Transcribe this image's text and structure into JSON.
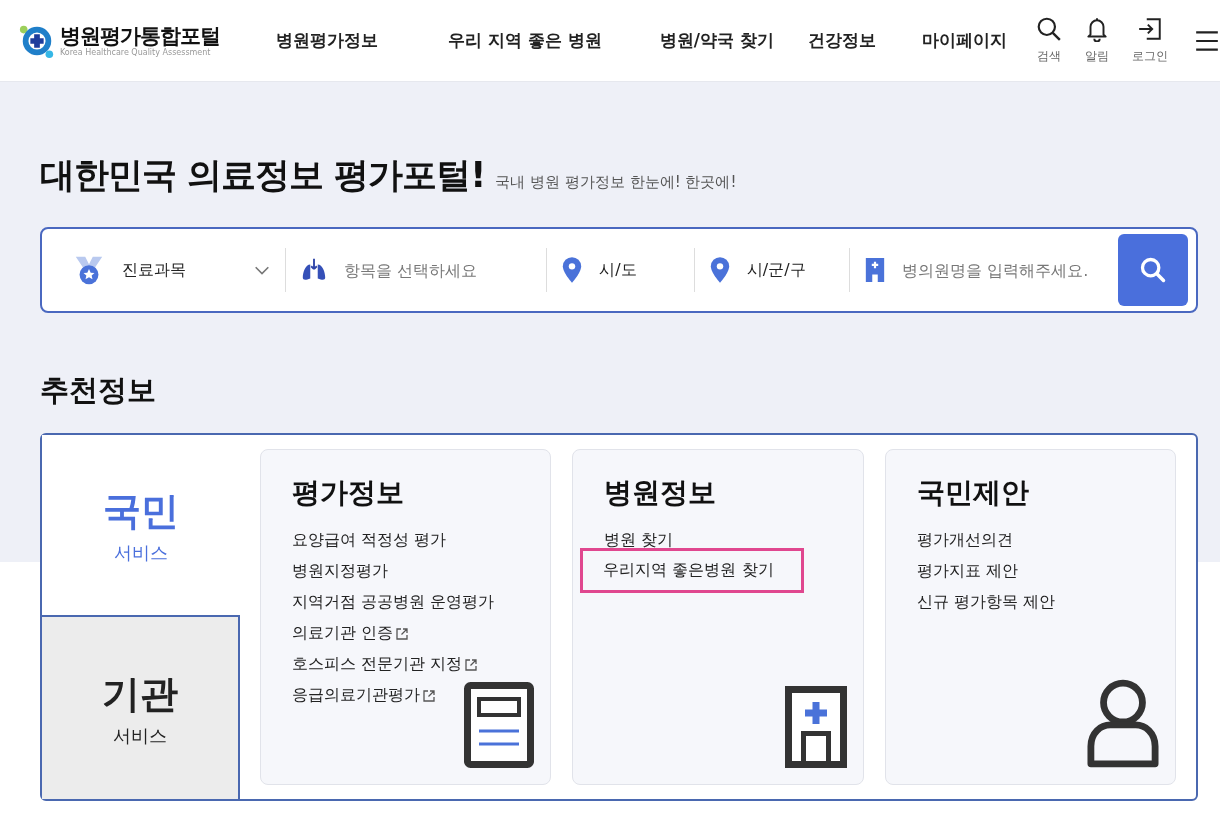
{
  "header": {
    "logo": {
      "title": "병원평가통합포털",
      "subtitle": "Korea Healthcare Quality Assessment"
    },
    "nav": [
      "병원평가정보",
      "우리 지역 좋은 병원",
      "병원/약국 찾기",
      "건강정보",
      "마이페이지"
    ],
    "actions": [
      {
        "kind": "search",
        "label": "검색"
      },
      {
        "kind": "bell",
        "label": "알림"
      },
      {
        "kind": "login",
        "label": "로그인"
      }
    ]
  },
  "hero": {
    "title": "대한민국 의료정보 평가포털!",
    "subtitle": "국내 병원 평가정보 한눈에! 한곳에!"
  },
  "search_bar": {
    "fields": [
      {
        "kind": "medal",
        "value": "진료과목",
        "dropdown": true
      },
      {
        "kind": "lungs",
        "placeholder": "항목을 선택하세요"
      },
      {
        "kind": "pin",
        "value": "시/도"
      },
      {
        "kind": "pin",
        "value": "시/군/구"
      },
      {
        "kind": "hospital",
        "placeholder": "병의원명을 입력해주세요."
      }
    ]
  },
  "recommend": {
    "title": "추천정보",
    "tabs": [
      {
        "title": "국민",
        "subtitle": "서비스",
        "selected": true
      },
      {
        "title": "기관",
        "subtitle": "서비스",
        "selected": false
      }
    ],
    "cards": [
      {
        "title": "평가정보",
        "links": [
          {
            "label": "요양급여 적정성 평가",
            "external": false,
            "highlighted": false
          },
          {
            "label": "병원지정평가",
            "external": false,
            "highlighted": false
          },
          {
            "label": "지역거점 공공병원 운영평가",
            "external": false,
            "highlighted": false
          },
          {
            "label": "의료기관 인증",
            "external": true,
            "highlighted": false
          },
          {
            "label": "호스피스 전문기관 지정",
            "external": true,
            "highlighted": false
          },
          {
            "label": "응급의료기관평가",
            "external": true,
            "highlighted": false
          }
        ]
      },
      {
        "title": "병원정보",
        "links": [
          {
            "label": "병원 찾기",
            "external": false,
            "highlighted": false
          },
          {
            "label": "우리지역 좋은병원 찾기",
            "external": false,
            "highlighted": true
          }
        ]
      },
      {
        "title": "국민제안",
        "links": [
          {
            "label": "평가개선의견",
            "external": false,
            "highlighted": false
          },
          {
            "label": "평가지표 제안",
            "external": false,
            "highlighted": false
          },
          {
            "label": "신규 평가항목 제안",
            "external": false,
            "highlighted": false
          }
        ]
      }
    ]
  }
}
